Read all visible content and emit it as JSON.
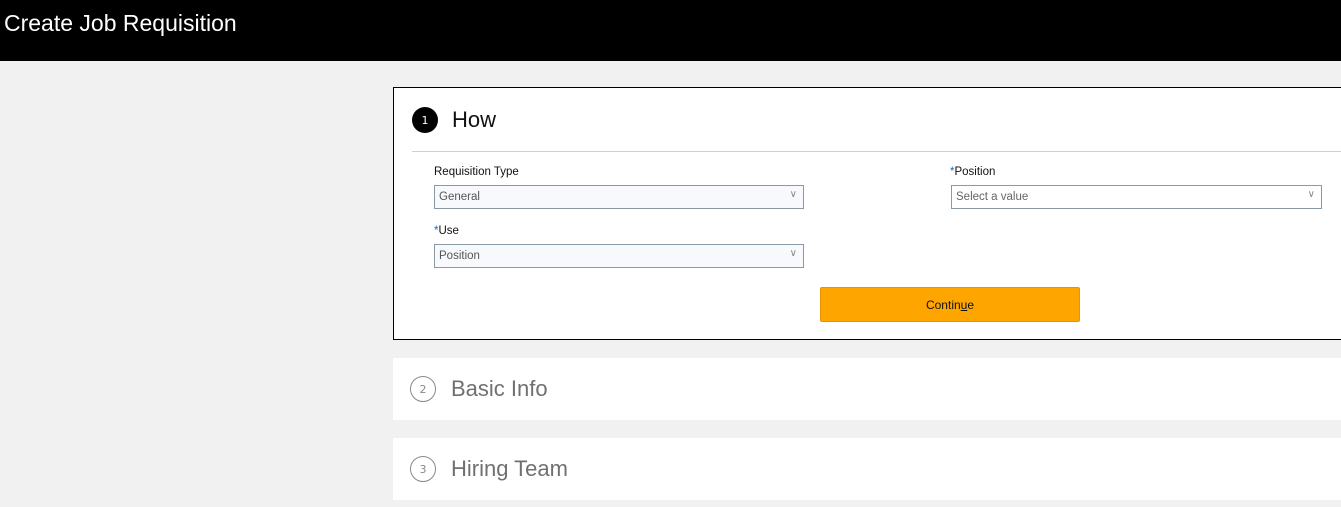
{
  "header": {
    "title": "Create Job Requisition"
  },
  "steps": [
    {
      "number": "1",
      "title": "How"
    },
    {
      "number": "2",
      "title": "Basic Info"
    },
    {
      "number": "3",
      "title": "Hiring Team"
    }
  ],
  "form": {
    "required_marker": "*",
    "requisition_type": {
      "label": "Requisition Type",
      "value": "General"
    },
    "use": {
      "label": "Use",
      "value": "Position"
    },
    "position": {
      "label": "Position",
      "placeholder": "Select a value"
    },
    "continue": {
      "label_pre": "Contin",
      "accesskey": "u",
      "label_post": "e"
    }
  },
  "icons": {
    "chevron": "∨"
  }
}
